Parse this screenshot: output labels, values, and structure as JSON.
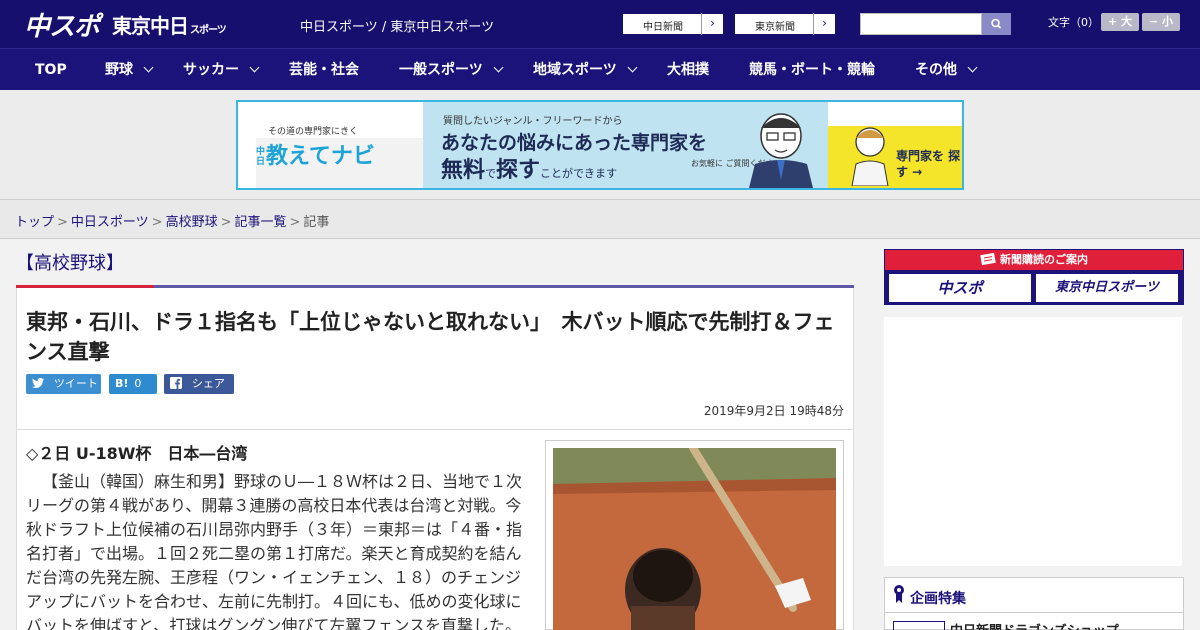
{
  "header": {
    "logo_main": "中スポ",
    "logo_tokyo": "東京中日",
    "logo_tokyo_small": "スポーツ",
    "site_title": "中日スポーツ / 東京中日スポーツ",
    "ext_links": [
      {
        "label": "中日新聞",
        "arrow": "›"
      },
      {
        "label": "東京新聞",
        "arrow": "›"
      }
    ],
    "search": {
      "placeholder": ""
    },
    "font_size": {
      "label": "文字（0）",
      "larger": "+ 大",
      "smaller": "− 小"
    }
  },
  "nav": {
    "items": [
      {
        "label": "TOP",
        "dropdown": false
      },
      {
        "label": "野球",
        "dropdown": true
      },
      {
        "label": "サッカー",
        "dropdown": true
      },
      {
        "label": "芸能・社会",
        "dropdown": false
      },
      {
        "label": "一般スポーツ",
        "dropdown": true
      },
      {
        "label": "地域スポーツ",
        "dropdown": true
      },
      {
        "label": "大相撲",
        "dropdown": false
      },
      {
        "label": "競馬・ボート・競輪",
        "dropdown": false
      },
      {
        "label": "その他",
        "dropdown": true
      }
    ]
  },
  "ad_banner": {
    "left_sub": "その道の専門家にきく",
    "left_main": "教えてナビ",
    "left_badge": "中日",
    "line1": "質問したいジャンル・フリーワードから",
    "line2": "あなたの悩みにあった専門家を",
    "line3_a": "無料",
    "line3_b": "で",
    "line3_c": "探す",
    "line3_d": "ことができます",
    "note": "お気軽に ご質問ください!",
    "cta": "専門家を 探す →"
  },
  "breadcrumb": {
    "items": [
      "トップ",
      "中日スポーツ",
      "高校野球",
      "記事一覧"
    ],
    "current": "記事",
    "separator": ">"
  },
  "article": {
    "category": "【高校野球】",
    "headline": "東邦・石川、ドラ１指名も「上位じゃないと取れない」　木バット順応で先制打＆フェンス直撃",
    "share": {
      "tweet": "ツイート",
      "hatena_count": "0",
      "facebook": "シェア 0"
    },
    "date": "2019年9月2日 19時48分",
    "subhead": "◇２日 U-18W杯　日本―台湾",
    "body": "【釜山（韓国）麻生和男】野球のＵ―１８Ｗ杯は２日、当地で１次リーグの第４戦があり、開幕３連勝の高校日本代表は台湾と対戦。今秋ドラフト上位候補の石川昂弥内野手（３年）＝東邦＝は「４番・指名打者」で出場。１回２死二塁の第１打席だ。楽天と育成契約を結んだ台湾の先発左腕、王彦程（ワン・イェンチェン、１８）のチェンジアップにバットを合わせ、左前に先制打。４回にも、低めの変化球にバットを伸ばすと、打球はグングン伸びて左翼フェンスを直撃した。"
  },
  "sidebar": {
    "subscribe_head": "新聞購読のご案内",
    "subscribe_logos": [
      "中スポ",
      "東京中日スポーツ"
    ],
    "feature_title": "企画特集",
    "feature_item": "中日新聞ドラゴンズショップ"
  },
  "colors": {
    "header_bg": "#160f6e",
    "accent_red": "#d6233c",
    "banner_border": "#3bb6e0"
  }
}
